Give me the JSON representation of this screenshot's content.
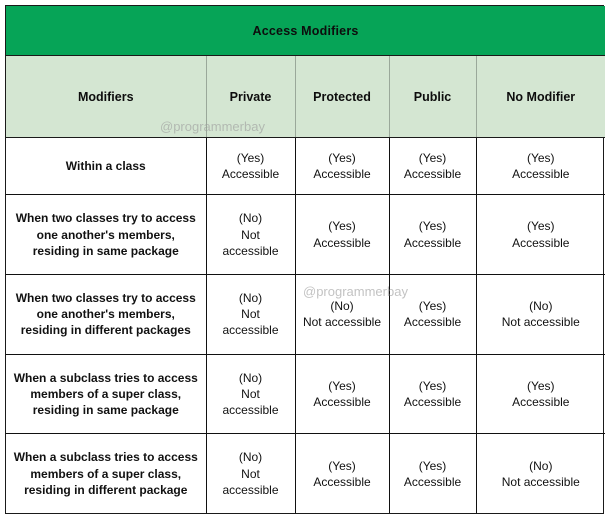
{
  "table": {
    "title": "Access Modifiers",
    "headers": [
      "Modifiers",
      "Private",
      "Protected",
      "Public",
      "No Modifier"
    ],
    "rows": [
      {
        "label": "Within a class",
        "cells": [
          {
            "verdict": "(Yes)",
            "detail": "Accessible"
          },
          {
            "verdict": "(Yes)",
            "detail": "Accessible"
          },
          {
            "verdict": "(Yes)",
            "detail": "Accessible"
          },
          {
            "verdict": "(Yes)",
            "detail": "Accessible"
          }
        ]
      },
      {
        "label": "When two classes try to access one another's members, residing in same package",
        "cells": [
          {
            "verdict": "(No)",
            "detail": "Not accessible"
          },
          {
            "verdict": "(Yes)",
            "detail": "Accessible"
          },
          {
            "verdict": "(Yes)",
            "detail": "Accessible"
          },
          {
            "verdict": "(Yes)",
            "detail": "Accessible"
          }
        ]
      },
      {
        "label": "When two classes try to access one another's members, residing in different packages",
        "cells": [
          {
            "verdict": "(No)",
            "detail": "Not accessible"
          },
          {
            "verdict": "(No)",
            "detail": "Not accessible"
          },
          {
            "verdict": "(Yes)",
            "detail": "Accessible"
          },
          {
            "verdict": "(No)",
            "detail": "Not accessible"
          }
        ]
      },
      {
        "label": "When a subclass tries to access members of a super class, residing in same package",
        "cells": [
          {
            "verdict": "(No)",
            "detail": "Not accessible"
          },
          {
            "verdict": "(Yes)",
            "detail": "Accessible"
          },
          {
            "verdict": "(Yes)",
            "detail": "Accessible"
          },
          {
            "verdict": "(Yes)",
            "detail": "Accessible"
          }
        ]
      },
      {
        "label": "When a subclass tries to access members of a super class, residing in different package",
        "cells": [
          {
            "verdict": "(No)",
            "detail": "Not accessible"
          },
          {
            "verdict": "(Yes)",
            "detail": "Accessible"
          },
          {
            "verdict": "(Yes)",
            "detail": "Accessible"
          },
          {
            "verdict": "(No)",
            "detail": "Not accessible"
          }
        ]
      }
    ]
  },
  "watermarks": {
    "top": "@programmerbay",
    "middle": "@programmerbay"
  },
  "colors": {
    "title_band": "#06A457",
    "header_band": "#D4E6D2",
    "border": "#1a1a1a",
    "text": "#111111",
    "watermark": "#9e9e9e"
  }
}
